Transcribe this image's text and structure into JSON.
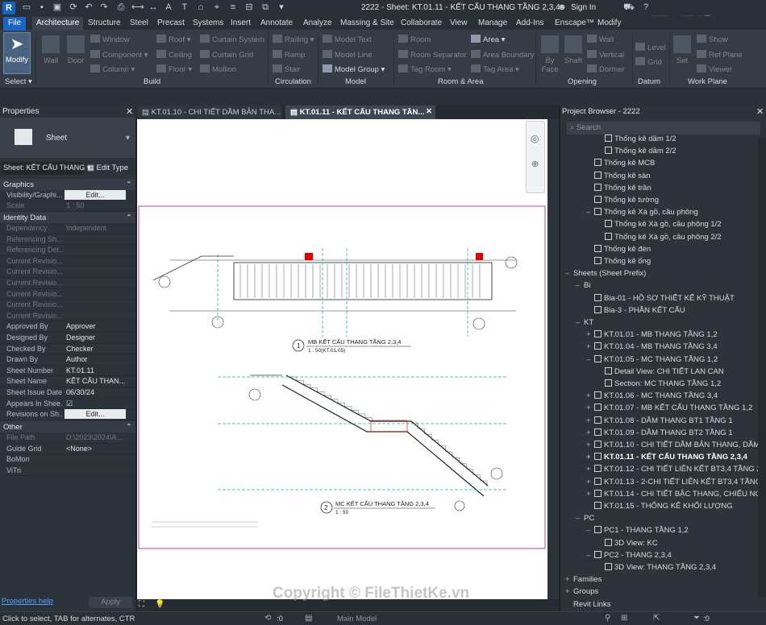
{
  "app": {
    "logo": "R",
    "title": "2222 - Sheet: KT.01.11 - KẾT CẤU THANG TẦNG 2,3,4",
    "signin": "Sign In"
  },
  "tabs": [
    "File",
    "Architecture",
    "Structure",
    "Steel",
    "Precast",
    "Systems",
    "Insert",
    "Annotate",
    "Analyze",
    "Massing & Site",
    "Collaborate",
    "View",
    "Manage",
    "Add-Ins",
    "Enscape™",
    "Modify"
  ],
  "ribbon": {
    "modify": "Modify",
    "select": "Select",
    "build": [
      "Wall",
      "Door",
      "Window",
      "Component",
      "Column",
      "Roof",
      "Ceiling",
      "Floor",
      "Curtain System",
      "Curtain Grid",
      "Mullion"
    ],
    "circulation": [
      "Railing",
      "Ramp",
      "Stair"
    ],
    "model": [
      "Model Text",
      "Model Line",
      "Model Group"
    ],
    "room": [
      "Room",
      "Room Separator",
      "Tag Room",
      "Area",
      "Area Boundary",
      "Tag Area"
    ],
    "opening": [
      "By Face",
      "Shaft",
      "Wall",
      "Vertical",
      "Dormer"
    ],
    "datum": [
      "Level",
      "Grid"
    ],
    "workplane": [
      "Set",
      "Show",
      "Ref Plane",
      "Viewer"
    ],
    "groups": [
      "Build",
      "Circulation",
      "Model",
      "Room & Area",
      "Opening",
      "Datum",
      "Work Plane"
    ]
  },
  "properties": {
    "title": "Properties",
    "type": "Sheet",
    "type_selector": "Sheet: KẾT CẤU THANG",
    "edit_type": "Edit Type",
    "graphics_head": "Graphics",
    "graphics": [
      {
        "k": "Visibility/Graphi...",
        "v": "Edit..."
      },
      {
        "k": "Scale",
        "v": "1 : 50"
      }
    ],
    "identity_head": "Identity Data",
    "identity": [
      {
        "k": "Dependency",
        "v": "Independent"
      },
      {
        "k": "Referencing Sh...",
        "v": ""
      },
      {
        "k": "Referencing Det...",
        "v": ""
      },
      {
        "k": "Current Revisio...",
        "v": ""
      },
      {
        "k": "Current Revisio...",
        "v": ""
      },
      {
        "k": "Current Revisio...",
        "v": ""
      },
      {
        "k": "Current Revisio...",
        "v": ""
      },
      {
        "k": "Current Revisio...",
        "v": ""
      },
      {
        "k": "Current Revisio...",
        "v": ""
      },
      {
        "k": "Approved By",
        "v": "Approver"
      },
      {
        "k": "Designed By",
        "v": "Designer"
      },
      {
        "k": "Checked By",
        "v": "Checker"
      },
      {
        "k": "Drawn By",
        "v": "Author"
      },
      {
        "k": "Sheet Number",
        "v": "KT.01.11"
      },
      {
        "k": "Sheet Name",
        "v": "KẾT CẤU THAN..."
      },
      {
        "k": "Sheet Issue Date",
        "v": "06/30/24"
      },
      {
        "k": "Appears In Shee...",
        "v": "☑"
      },
      {
        "k": "Revisions on Sh...",
        "v": "Edit..."
      }
    ],
    "other_head": "Other",
    "other": [
      {
        "k": "File Path",
        "v": "D:\\2023\\2024\\A..."
      },
      {
        "k": "Guide Grid",
        "v": "<None>"
      },
      {
        "k": "BoMon",
        "v": ""
      },
      {
        "k": "ViTri",
        "v": ""
      }
    ],
    "help": "Properties help",
    "apply": "Apply"
  },
  "viewtabs": [
    "KT.01.10 - CHI TIẾT DẦM BẢN THA...",
    "KT.01.11 - KẾT CẤU THANG TẦN..."
  ],
  "drawing": {
    "title1": "MB KẾT CẤU THANG TẦNG 2,3,4",
    "scale1": "1 : 50(KT.01.05)",
    "title2": "MC KẾT CẤU THANG TẦNG 2,3,4",
    "scale2": "1 : 50",
    "num1": "1",
    "num2": "2"
  },
  "browser": {
    "title": "Project Browser - 2222",
    "search": "Search",
    "items": [
      {
        "t": "Thống kê dầm 1/2",
        "l": 3,
        "e": ""
      },
      {
        "t": "Thống kê dầm 2/2",
        "l": 3,
        "e": ""
      },
      {
        "t": "Thống kê MCB",
        "l": 2,
        "e": ""
      },
      {
        "t": "Thống kê sàn",
        "l": 2,
        "e": ""
      },
      {
        "t": "Thống kê trần",
        "l": 2,
        "e": ""
      },
      {
        "t": "Thống kê tường",
        "l": 2,
        "e": ""
      },
      {
        "t": "Thống kê Xà gồ, cầu phông",
        "l": 2,
        "e": "–"
      },
      {
        "t": "Thống kê Xà gồ, cầu phông 1/2",
        "l": 3,
        "e": ""
      },
      {
        "t": "Thống kê Xà gồ, cầu phông 2/2",
        "l": 3,
        "e": ""
      },
      {
        "t": "Thống kê đèn",
        "l": 2,
        "e": ""
      },
      {
        "t": "Thống kê ống",
        "l": 2,
        "e": ""
      },
      {
        "t": "Sheets (Sheet Prefix)",
        "l": 0,
        "e": "–"
      },
      {
        "t": "Bi",
        "l": 1,
        "e": "–"
      },
      {
        "t": "Bia-01 - HỒ SƠ THIẾT KẾ KỸ THUẬT",
        "l": 2,
        "e": ""
      },
      {
        "t": "Bia-3 - PHẦN KẾT CẤU",
        "l": 2,
        "e": ""
      },
      {
        "t": "KT",
        "l": 1,
        "e": "–"
      },
      {
        "t": "KT.01.01 - MB THANG TẦNG 1,2",
        "l": 2,
        "e": "+"
      },
      {
        "t": "KT.01.04 - MB THANG TẦNG 3,4",
        "l": 2,
        "e": "+"
      },
      {
        "t": "KT.01.05 - MC THANG TẦNG 1,2",
        "l": 2,
        "e": "–"
      },
      {
        "t": "Detail View: CHI TIẾT LAN CAN",
        "l": 3,
        "e": ""
      },
      {
        "t": "Section: MC THANG TẦNG 1,2",
        "l": 3,
        "e": ""
      },
      {
        "t": "KT.01.06 - MC THANG TẦNG 3,4",
        "l": 2,
        "e": "+"
      },
      {
        "t": "KT.01.07 - MB KẾT CẤU THANG TẦNG 1,2",
        "l": 2,
        "e": "+"
      },
      {
        "t": "KT.01.08 - DẦM THANG BT1 TẦNG 1",
        "l": 2,
        "e": "+"
      },
      {
        "t": "KT.01.09 - DẦM THANG BT2 TẦNG 1",
        "l": 2,
        "e": "+"
      },
      {
        "t": "KT.01.10 - CHI TIẾT DẦM BẢN THANG, DẦM CHIẾU",
        "l": 2,
        "e": "+"
      },
      {
        "t": "KT.01.11 - KẾT CẤU THANG TẦNG 2,3,4",
        "l": 2,
        "e": "+",
        "sel": true
      },
      {
        "t": "KT.01.12 - CHI TIẾT LIÊN KẾT BT3,4 TẦNG 2,3,4",
        "l": 2,
        "e": "+"
      },
      {
        "t": "KT.01.13 - 2-CHI TIẾT LIÊN KẾT BT3,4 TẦNG 2,3,4",
        "l": 2,
        "e": "+"
      },
      {
        "t": "KT.01.14 - CHI TIẾT BẬC THANG, CHIẾU NGHỈ",
        "l": 2,
        "e": "+"
      },
      {
        "t": "KT.01.15 - THỐNG KÊ KHỐI LƯỢNG",
        "l": 2,
        "e": ""
      },
      {
        "t": "PC",
        "l": 1,
        "e": "–"
      },
      {
        "t": "PC1 - THANG TẦNG 1,2",
        "l": 2,
        "e": "–"
      },
      {
        "t": "3D View: KC",
        "l": 3,
        "e": ""
      },
      {
        "t": "PC2 - THANG 2,3,4",
        "l": 2,
        "e": "–"
      },
      {
        "t": "3D View: THANG TẦNG 2,3,4",
        "l": 3,
        "e": ""
      },
      {
        "t": "Families",
        "l": 0,
        "e": "+"
      },
      {
        "t": "Groups",
        "l": 0,
        "e": "+"
      },
      {
        "t": "Revit Links",
        "l": 0,
        "e": ""
      }
    ]
  },
  "status": {
    "hint": "Click to select, TAB for alternates, CTR",
    "zero1": ":0",
    "model": "Main Model",
    "zero2": ":0"
  },
  "watermark": "Copyright © FileThietKe.vn",
  "brand": "File Thiết Kế.vn"
}
